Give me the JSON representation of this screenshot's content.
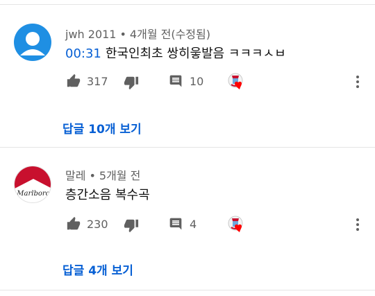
{
  "comments": [
    {
      "author": "jwh 2011",
      "separator": "•",
      "time": "4개월 전(수정됨)",
      "timestamp_link": "00:31",
      "text": "한국인최초 쌍히읗발음 ㅋㅋㅋㅅㅂ",
      "likes": "317",
      "reply_count": "10",
      "replies_label": "답글 10개 보기",
      "avatar_icon": "default-user-avatar",
      "avatar_color": "#1f8fe3"
    },
    {
      "author": "말레",
      "separator": "•",
      "time": "5개월 전",
      "text": "층간소음 복수곡",
      "likes": "230",
      "reply_count": "4",
      "replies_label": "답글 4개 보기",
      "avatar_icon": "marlboro-logo-avatar",
      "avatar_text": "Marlboro"
    }
  ],
  "icons": {
    "like": "thumbs-up-icon",
    "dislike": "thumbs-down-icon",
    "reply": "comment-icon",
    "creator_heart": "creator-heart-badge",
    "more": "more-vert-icon"
  },
  "colors": {
    "link": "#065fd4",
    "secondary_text": "#606060",
    "heart": "#ff0000",
    "divider": "#e5e5e5"
  }
}
